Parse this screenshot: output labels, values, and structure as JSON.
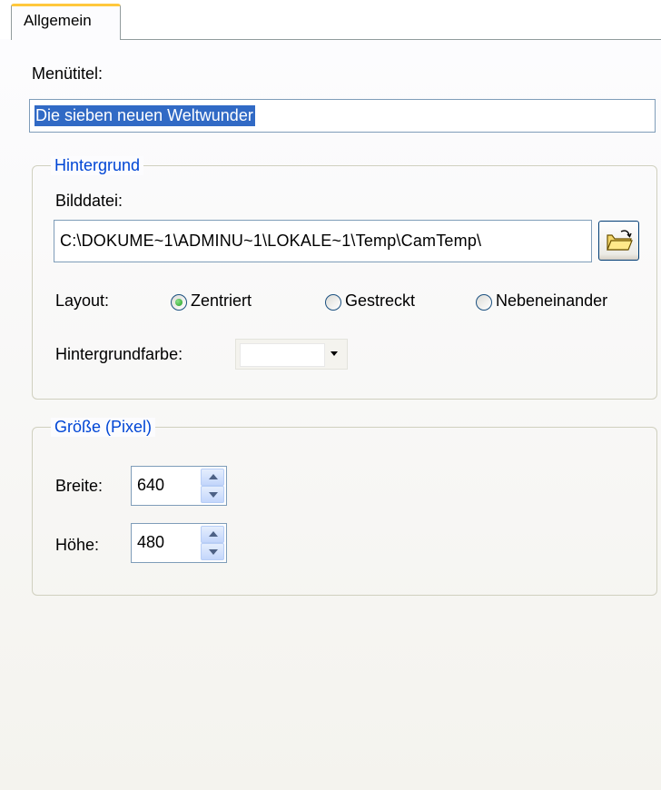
{
  "tabs": [
    {
      "label": "Allgemein",
      "active": true
    }
  ],
  "menu_title": {
    "label": "Menütitel:",
    "value": "Die sieben neuen Weltwunder"
  },
  "background": {
    "group_label": "Hintergrund",
    "image_file_label": "Bilddatei:",
    "image_file_value": "C:\\DOKUME~1\\ADMINU~1\\LOKALE~1\\Temp\\CamTemp\\",
    "browse_icon": "open-folder-icon",
    "layout_label": "Layout:",
    "layout_options": [
      {
        "label": "Zentriert",
        "selected": true
      },
      {
        "label": "Gestreckt",
        "selected": false
      },
      {
        "label": "Nebeneinander",
        "selected": false
      }
    ],
    "color_label": "Hintergrundfarbe:",
    "color_value": "#ffffff"
  },
  "size": {
    "group_label": "Größe (Pixel)",
    "width_label": "Breite:",
    "width_value": "640",
    "height_label": "Höhe:",
    "height_value": "480"
  },
  "colors": {
    "accent_tab": "#ffc83c",
    "group_legend": "#0046d5",
    "selection": "#316ac5",
    "field_border": "#7f9db9"
  }
}
